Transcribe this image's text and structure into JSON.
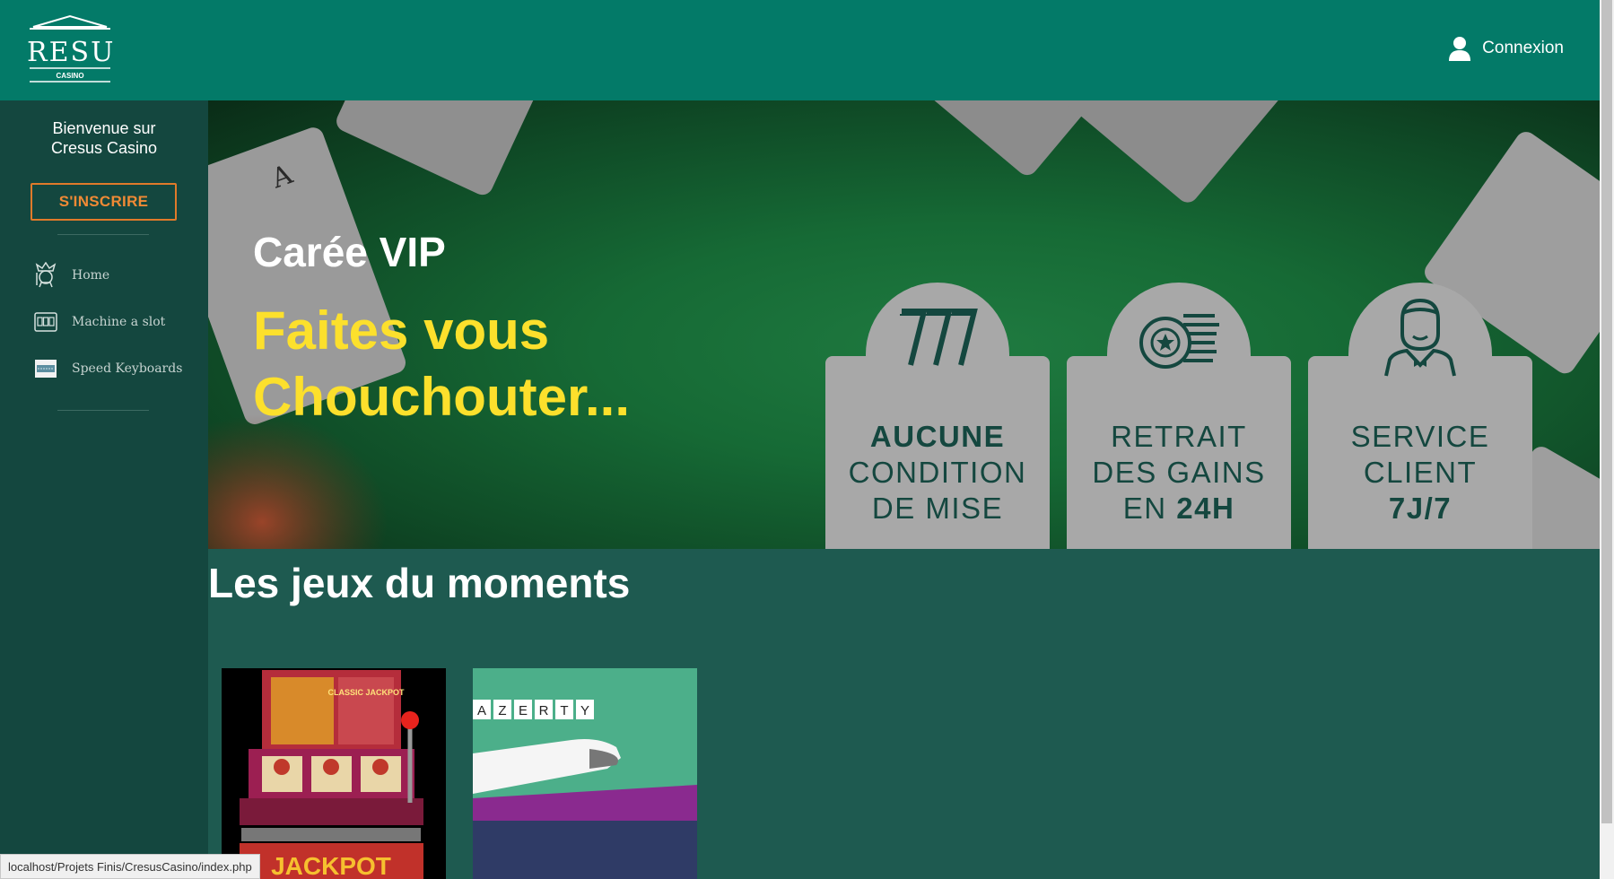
{
  "header": {
    "logo_text": "CRESUS",
    "logo_subtext": "CASINO",
    "login_label": "Connexion"
  },
  "sidebar": {
    "welcome_line1": "Bienvenue sur",
    "welcome_line2": "Cresus Casino",
    "signup_label": "S'INSCRIRE",
    "items": [
      {
        "label": "Home",
        "icon": "jester-icon"
      },
      {
        "label": "Machine a slot",
        "icon": "slot-machine-icon"
      },
      {
        "label": "Speed Keyboards",
        "icon": "keyboard-icon"
      }
    ]
  },
  "hero": {
    "title": "Carée VIP",
    "tagline_line1": "Faites vous",
    "tagline_line2": "Chouchouter...",
    "panels": [
      {
        "icon": "777-icon",
        "line1": "AUCUNE",
        "line2": "CONDITION",
        "line3": "DE MISE"
      },
      {
        "icon": "coins-icon",
        "line1": "RETRAIT",
        "line2": "DES GAINS",
        "line3_pre": "EN ",
        "line3_bold": "24H"
      },
      {
        "icon": "support-agent-icon",
        "line1": "SERVICE",
        "line2": "CLIENT",
        "line3": "7J/7"
      }
    ],
    "colors": {
      "title": "#ffffff",
      "tagline": "#fce02c",
      "panel": "#a8a8a8",
      "panel_text": "#14473f"
    }
  },
  "games_section": {
    "title": "Les jeux du moments",
    "games": [
      {
        "name": "slot-machine",
        "label": "JACKPOT",
        "sign": "CLASSIC JACKPOT"
      },
      {
        "name": "speed-keyboards",
        "keys": [
          "A",
          "Z",
          "E",
          "R",
          "T",
          "Y"
        ]
      }
    ]
  },
  "statusbar": {
    "url": "localhost/Projets Finis/CresusCasino/index.php"
  },
  "colors": {
    "header": "#037a68",
    "sidebar": "#14473f",
    "page": "#1e5a50",
    "accent": "#f08a35"
  }
}
